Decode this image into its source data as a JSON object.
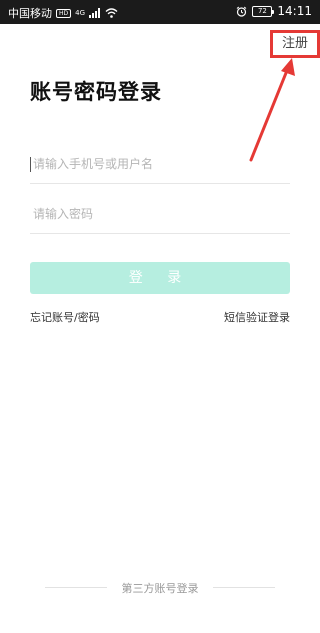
{
  "status_bar": {
    "carrier": "中国移动",
    "hd_badge": "HD",
    "network_type": "4G",
    "battery": "72",
    "time": "14:11",
    "icons": [
      "signal-bars-icon",
      "wifi-icon",
      "alarm-icon",
      "battery-icon"
    ]
  },
  "header": {
    "register_label": "注册"
  },
  "login_form": {
    "title": "账号密码登录",
    "username_placeholder": "请输入手机号或用户名",
    "password_placeholder": "请输入密码",
    "login_button_label": "登 录",
    "forgot_label": "忘记账号/密码",
    "sms_login_label": "短信验证登录"
  },
  "footer": {
    "third_party_label": "第三方账号登录"
  },
  "colors": {
    "login_button_bg": "#b6eee0",
    "annotation": "#e53935"
  }
}
